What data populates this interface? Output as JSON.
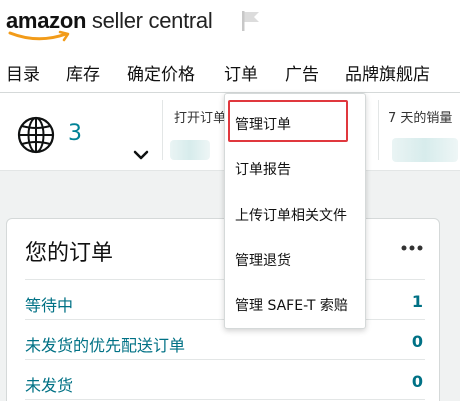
{
  "header": {
    "logo_amazon": "amazon",
    "logo_rest": " seller central"
  },
  "nav": {
    "items": [
      "目录",
      "库存",
      "确定价格",
      "订单",
      "广告",
      "品牌旗舰店"
    ],
    "active_index": 3
  },
  "stats": {
    "marketplace_count": "3",
    "open_orders_label": "打开订单",
    "sales_7d_label": "7 天的销量"
  },
  "dropdown": {
    "items": [
      "管理订单",
      "订单报告",
      "上传订单相关文件",
      "管理退货",
      "管理 SAFE-T 索赔"
    ],
    "highlighted_index": 0
  },
  "orders_card": {
    "title": "您的订单",
    "rows": [
      {
        "label": "等待中",
        "count": "1"
      },
      {
        "label": "未发货的优先配送订单",
        "count": "0"
      },
      {
        "label": "未发货",
        "count": "0"
      }
    ]
  },
  "colors": {
    "link": "#007185",
    "accent_teal": "#008296",
    "highlight_border": "#e0383e",
    "page_gray": "#f0f2f2"
  }
}
